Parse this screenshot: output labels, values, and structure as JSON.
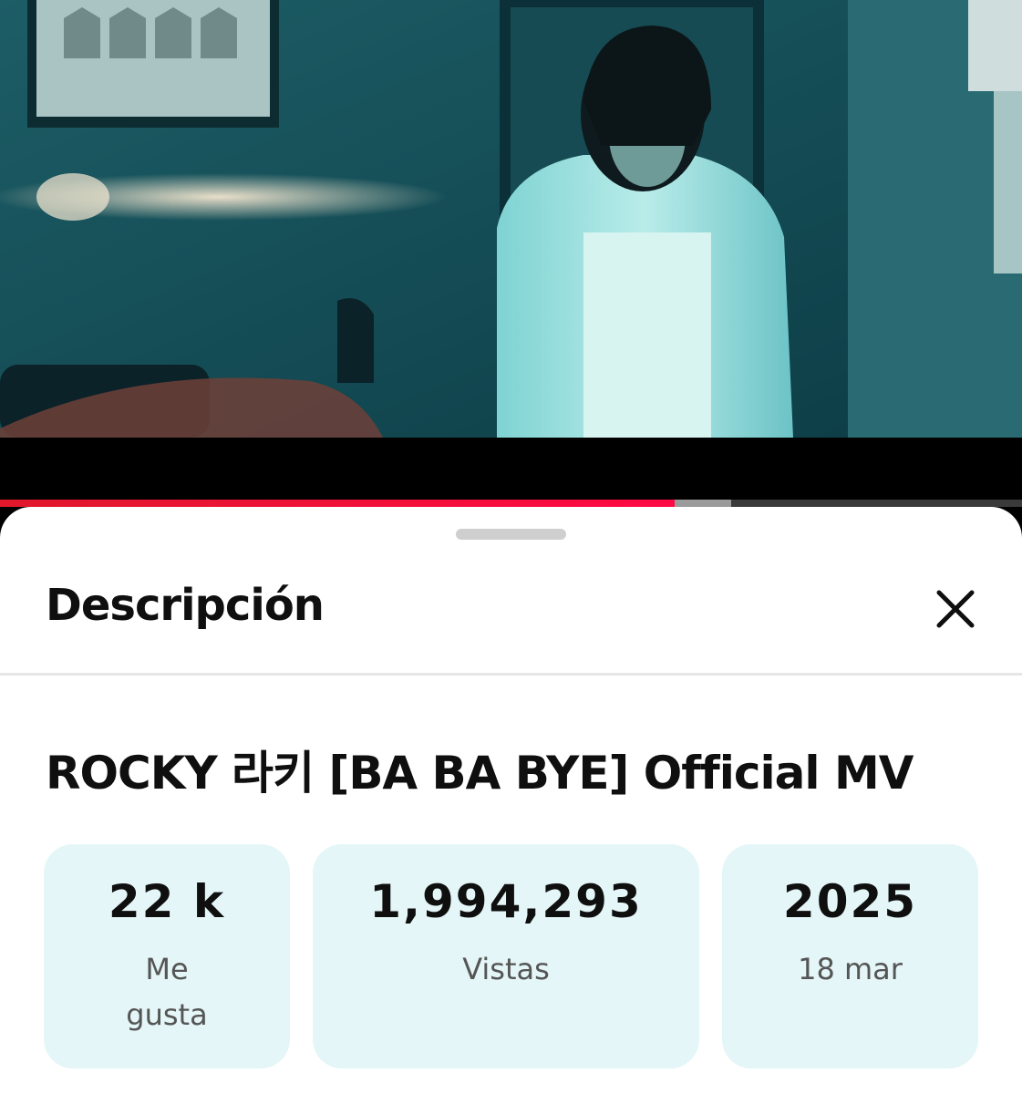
{
  "player": {
    "progress_played": 0.66,
    "progress_buffered": 0.715,
    "colors": {
      "played": "#ff0033",
      "buffered": "#9a9a9a",
      "track": "#3a3a3a"
    }
  },
  "sheet": {
    "title": "Descripción",
    "close_icon": "close-icon"
  },
  "video": {
    "title": "ROCKY 라키 [BA BA BYE] Official MV"
  },
  "stats": {
    "likes": {
      "value": "22 k",
      "label": "Me gusta"
    },
    "views": {
      "value": "1,994,293",
      "label": "Vistas"
    },
    "date": {
      "value": "2025",
      "label": "18 mar"
    }
  },
  "colors": {
    "stat_background": "#e4f6f7",
    "sheet_background": "#ffffff"
  }
}
